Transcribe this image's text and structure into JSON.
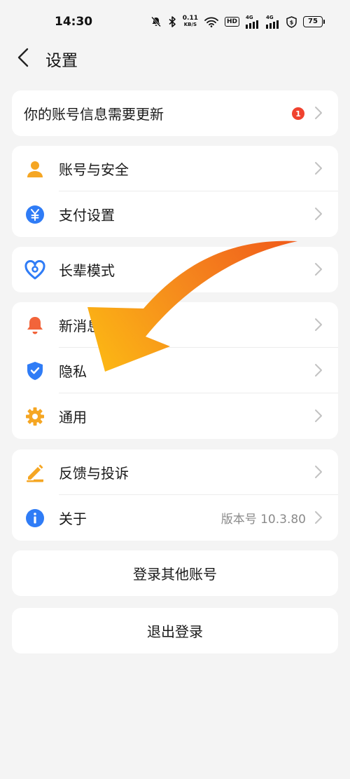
{
  "status_bar": {
    "time": "14:30",
    "net_speed_value": "0.11",
    "net_speed_unit": "KB/S",
    "hd_label": "HD",
    "signal1_label": "4G",
    "signal2_label": "4G",
    "battery": "75"
  },
  "header": {
    "title": "设置"
  },
  "notice": {
    "label": "你的账号信息需要更新",
    "badge": "1"
  },
  "group1": [
    {
      "label": "账号与安全",
      "icon": "person-icon"
    },
    {
      "label": "支付设置",
      "icon": "yuan-icon"
    }
  ],
  "group2": [
    {
      "label": "长辈模式",
      "icon": "heart-icon"
    }
  ],
  "group3": [
    {
      "label": "新消息通知",
      "icon": "bell-icon"
    },
    {
      "label": "隐私",
      "icon": "shield-icon"
    },
    {
      "label": "通用",
      "icon": "gear-icon"
    }
  ],
  "group4": [
    {
      "label": "反馈与投诉",
      "icon": "pencil-icon"
    },
    {
      "label": "关于",
      "icon": "info-icon",
      "value": "版本号 10.3.80"
    }
  ],
  "buttons": {
    "switch_account": "登录其他账号",
    "logout": "退出登录"
  },
  "colors": {
    "background": "#f4f4f4",
    "card": "#ffffff",
    "orange": "#f5a623",
    "blue": "#2f7cf6",
    "badge_red": "#f0422f",
    "arrow_start": "#f26a1b",
    "arrow_end": "#fbb714"
  }
}
